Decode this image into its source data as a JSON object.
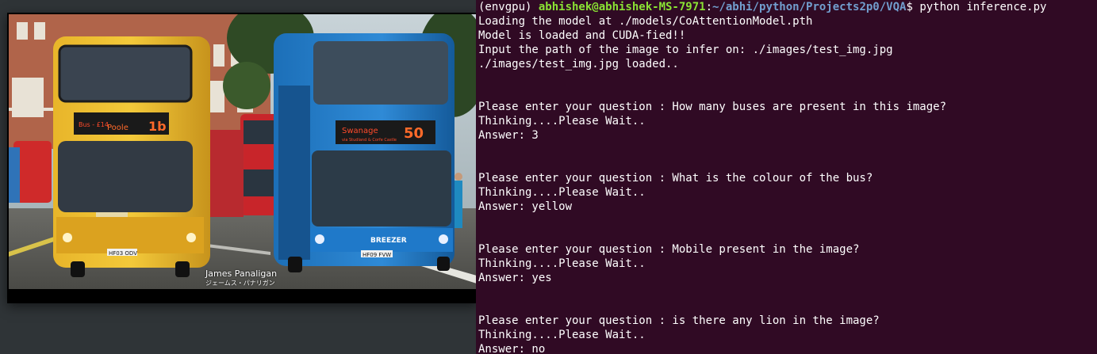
{
  "image_viewer": {
    "photo_credit": "James Panaligan",
    "photo_credit_sub": "ジェームス・パナリガン",
    "bus_left_destination": "Poole",
    "bus_left_route_prefix": "Bus - £14",
    "bus_left_number": "1b",
    "bus_left_plate": "HF03 ODV",
    "bus_right_destination": "Swanage",
    "bus_right_destination_sub": "via Studland & Corfe Castle",
    "bus_right_number": "50",
    "bus_right_brand": "BREEZER",
    "bus_right_plate": "HF09 FVW"
  },
  "terminal": {
    "prompt_env": "(envgpu) ",
    "prompt_user": "abhishek@abhishek-MS-7971",
    "prompt_sep": ":",
    "prompt_path": "~/abhi/python/Projects2p0/VQA",
    "prompt_end": "$ ",
    "command": "python inference.py",
    "lines": [
      "Loading the model at ./models/CoAttentionModel.pth",
      "Model is loaded and CUDA-fied!!",
      "Input the path of the image to infer on: ./images/test_img.jpg",
      "./images/test_img.jpg loaded..",
      "",
      "",
      "Please enter your question : How many buses are present in this image?",
      "Thinking....Please Wait..",
      "Answer: 3",
      "",
      "",
      "Please enter your question : What is the colour of the bus?",
      "Thinking....Please Wait..",
      "Answer: yellow",
      "",
      "",
      "Please enter your question : Mobile present in the image?",
      "Thinking....Please Wait..",
      "Answer: yes",
      "",
      "",
      "Please enter your question : is there any lion in the image?",
      "Thinking....Please Wait..",
      "Answer: no"
    ]
  },
  "colors": {
    "terminal_bg": "#300a24",
    "prompt_user": "#8ae234",
    "prompt_path": "#729fcf",
    "desktop_bg": "#2f3437"
  }
}
